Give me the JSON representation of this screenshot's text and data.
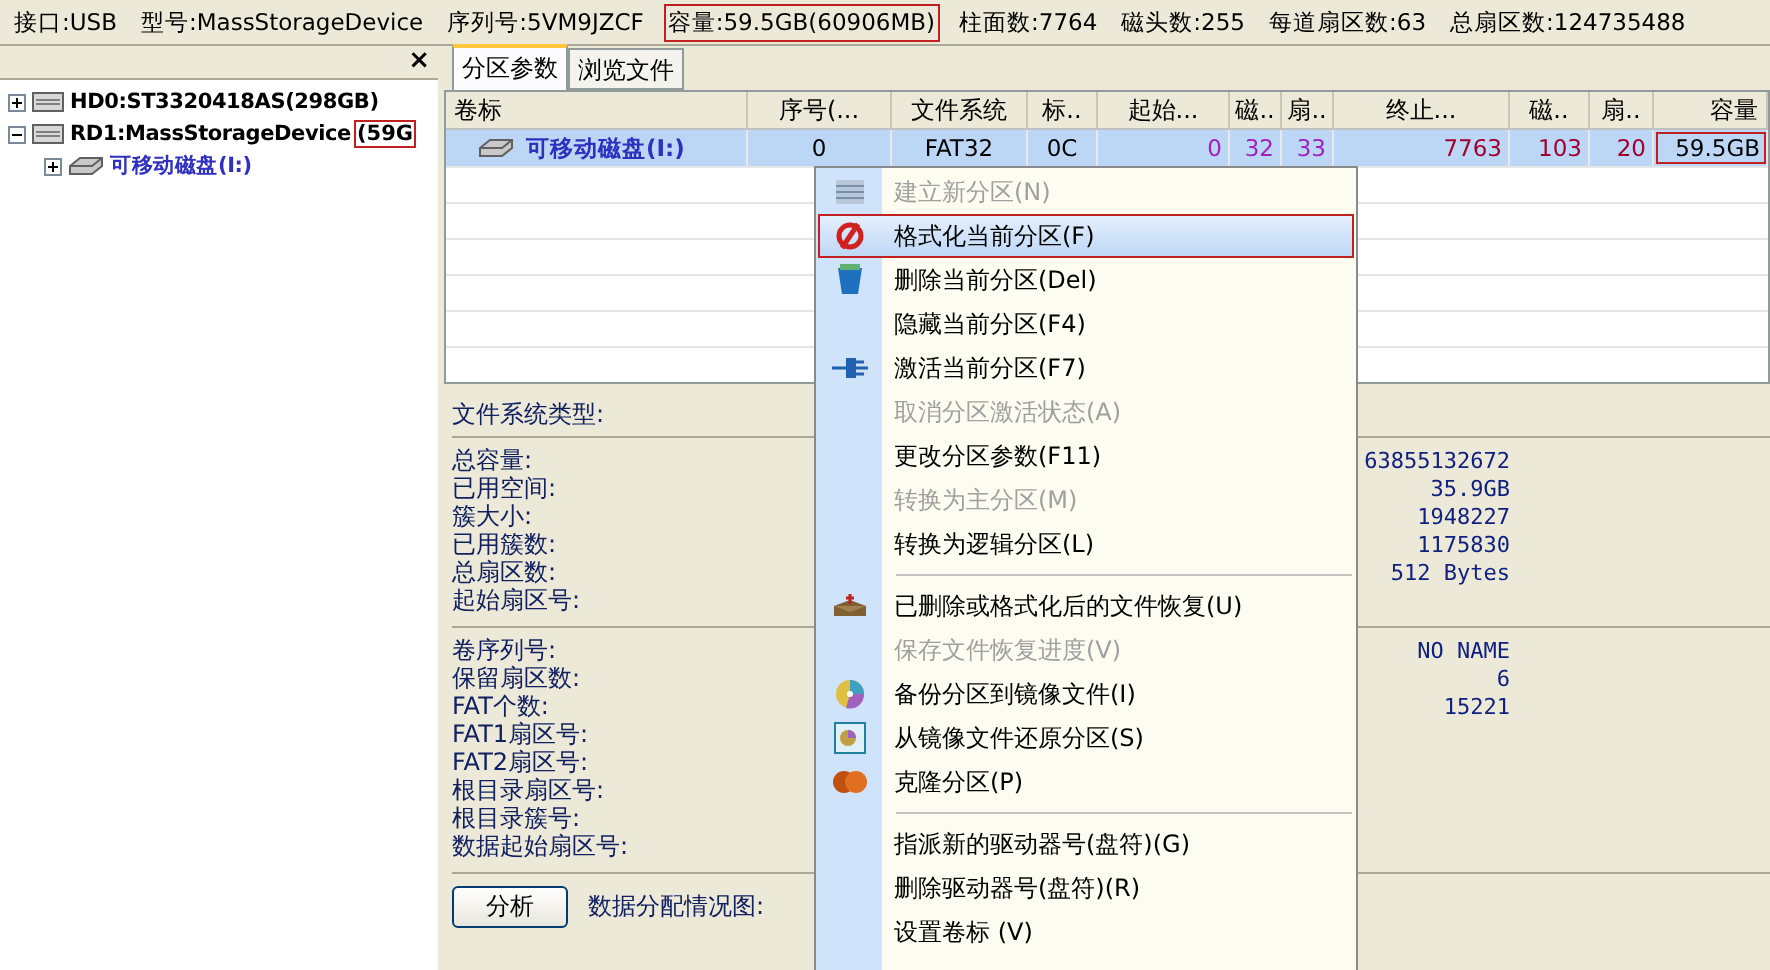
{
  "info_bar": [
    {
      "label": "接口:USB",
      "highlighted": false
    },
    {
      "label": "型号:MassStorageDevice",
      "highlighted": false
    },
    {
      "label": "序列号:5VM9JZCF",
      "highlighted": false
    },
    {
      "label": "容量:59.5GB(60906MB)",
      "highlighted": true
    },
    {
      "label": "柱面数:7764",
      "highlighted": false
    },
    {
      "label": "磁头数:255",
      "highlighted": false
    },
    {
      "label": "每道扇区数:63",
      "highlighted": false
    },
    {
      "label": "总扇区数:124735488",
      "highlighted": false
    }
  ],
  "tree": {
    "close": "×",
    "items": [
      {
        "label": "HD0:ST3320418AS(298GB)",
        "kind": "disk",
        "expanded": false
      },
      {
        "label": "RD1:MassStorageDevice",
        "size": "(59G",
        "size_highlighted": true,
        "kind": "disk",
        "expanded": true,
        "children": [
          {
            "label": "可移动磁盘(I:)",
            "kind": "partition",
            "expanded": false
          }
        ]
      }
    ]
  },
  "tabs": [
    {
      "label": "分区参数",
      "selected": true
    },
    {
      "label": "浏览文件",
      "selected": false
    }
  ],
  "table": {
    "columns": [
      "卷标",
      "序号(...",
      "文件系统",
      "标..",
      "起始...",
      "磁..",
      "扇..",
      "终止...",
      "磁..",
      "扇..",
      "容量"
    ],
    "rows": [
      {
        "selected": true,
        "cells": [
          {
            "text": "可移动磁盘(I:)",
            "color": "#3030c0",
            "highlighted": false
          },
          {
            "text": "0",
            "color": "#000000",
            "highlighted": false
          },
          {
            "text": "FAT32",
            "color": "#000000",
            "highlighted": false
          },
          {
            "text": "0C",
            "color": "#000000",
            "highlighted": false
          },
          {
            "text": "0",
            "color": "#a020c0",
            "highlighted": false
          },
          {
            "text": "32",
            "color": "#a020c0",
            "highlighted": false
          },
          {
            "text": "33",
            "color": "#a020c0",
            "highlighted": false
          },
          {
            "text": "7763",
            "color": "#a00030",
            "highlighted": false
          },
          {
            "text": "103",
            "color": "#a00030",
            "highlighted": false
          },
          {
            "text": "20",
            "color": "#a00030",
            "highlighted": false
          },
          {
            "text": "59.5GB",
            "color": "#000000",
            "highlighted": true
          }
        ]
      }
    ]
  },
  "details": {
    "heading": "文件系统类型:",
    "groups": [
      [
        {
          "label": "总容量:",
          "value": "63855132672"
        },
        {
          "label": "已用空间:",
          "value": "35.9GB"
        },
        {
          "label": "簇大小:",
          "value": "1948227"
        },
        {
          "label": "已用簇数:",
          "value": "1175830"
        },
        {
          "label": "总扇区数:",
          "value": "512 Bytes"
        },
        {
          "label": "起始扇区号:"
        }
      ],
      [
        {
          "label": "卷序列号:",
          "value": "NO NAME"
        },
        {
          "label": "保留扇区数:",
          "value": "6"
        },
        {
          "label": "FAT个数:",
          "value": "15221"
        },
        {
          "label": "FAT1扇区号:"
        },
        {
          "label": "FAT2扇区号:"
        },
        {
          "label": "根目录扇区号:"
        },
        {
          "label": "根目录簇号:"
        },
        {
          "label": "数据起始扇区号:"
        }
      ]
    ],
    "analyze_button": "分析",
    "map_label": "数据分配情况图:"
  },
  "context_menu": [
    {
      "kind": "item",
      "label": "建立新分区(N)",
      "disabled": true,
      "selected": false,
      "highlighted": false
    },
    {
      "kind": "item",
      "label": "格式化当前分区(F)",
      "disabled": false,
      "selected": true,
      "highlighted": true
    },
    {
      "kind": "item",
      "label": "删除当前分区(Del)",
      "disabled": false,
      "selected": false,
      "highlighted": false
    },
    {
      "kind": "item",
      "label": "隐藏当前分区(F4)",
      "disabled": false,
      "selected": false,
      "highlighted": false
    },
    {
      "kind": "item",
      "label": "激活当前分区(F7)",
      "disabled": false,
      "selected": false,
      "highlighted": false
    },
    {
      "kind": "item",
      "label": "取消分区激活状态(A)",
      "disabled": true,
      "selected": false,
      "highlighted": false
    },
    {
      "kind": "item",
      "label": "更改分区参数(F11)",
      "disabled": false,
      "selected": false,
      "highlighted": false
    },
    {
      "kind": "item",
      "label": "转换为主分区(M)",
      "disabled": true,
      "selected": false,
      "highlighted": false
    },
    {
      "kind": "item",
      "label": "转换为逻辑分区(L)",
      "disabled": false,
      "selected": false,
      "highlighted": false
    },
    {
      "kind": "separator"
    },
    {
      "kind": "item",
      "label": "已删除或格式化后的文件恢复(U)",
      "disabled": false,
      "selected": false,
      "highlighted": false
    },
    {
      "kind": "item",
      "label": "保存文件恢复进度(V)",
      "disabled": true,
      "selected": false,
      "highlighted": false
    },
    {
      "kind": "item",
      "label": "备份分区到镜像文件(I)",
      "disabled": false,
      "selected": false,
      "highlighted": false
    },
    {
      "kind": "item",
      "label": "从镜像文件还原分区(S)",
      "disabled": false,
      "selected": false,
      "highlighted": false
    },
    {
      "kind": "item",
      "label": "克隆分区(P)",
      "disabled": false,
      "selected": false,
      "highlighted": false
    },
    {
      "kind": "separator"
    },
    {
      "kind": "item",
      "label": "指派新的驱动器号(盘符)(G)",
      "disabled": false,
      "selected": false,
      "highlighted": false
    },
    {
      "kind": "item",
      "label": "删除驱动器号(盘符)(R)",
      "disabled": false,
      "selected": false,
      "highlighted": false
    },
    {
      "kind": "item",
      "label": "设置卷标 (V)",
      "disabled": false,
      "selected": false,
      "highlighted": false
    }
  ]
}
